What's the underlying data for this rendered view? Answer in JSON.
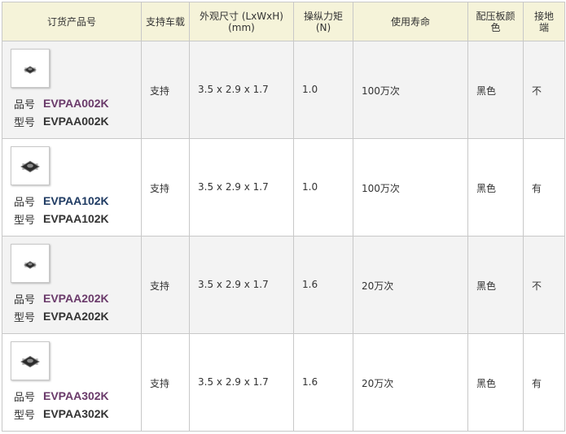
{
  "headers": {
    "product_no": "订货产品号",
    "car_support": "支持车载",
    "dimensions": "外观尺寸 (LxWxH)\n(mm)",
    "force": "操纵力矩\n(N)",
    "life": "使用寿命",
    "plate_color": "配压板颜色",
    "ground_terminal": "接地端"
  },
  "labels": {
    "pin": "品号",
    "model": "型号"
  },
  "rows": [
    {
      "pin": "EVPAA002K",
      "pin_color": "#6a3a6a",
      "model": "EVPAA002K",
      "car_support": "支持",
      "dimensions": "3.5 x 2.9 x 1.7",
      "force": "1.0",
      "life": "100万次",
      "plate_color": "黑色",
      "ground_terminal": "不",
      "thumb_size": "small"
    },
    {
      "pin": "EVPAA102K",
      "pin_color": "#1f3b63",
      "model": "EVPAA102K",
      "car_support": "支持",
      "dimensions": "3.5 x 2.9 x 1.7",
      "force": "1.0",
      "life": "100万次",
      "plate_color": "黑色",
      "ground_terminal": "有",
      "thumb_size": "large"
    },
    {
      "pin": "EVPAA202K",
      "pin_color": "#6a3a6a",
      "model": "EVPAA202K",
      "car_support": "支持",
      "dimensions": "3.5 x 2.9 x 1.7",
      "force": "1.6",
      "life": "20万次",
      "plate_color": "黑色",
      "ground_terminal": "不",
      "thumb_size": "small"
    },
    {
      "pin": "EVPAA302K",
      "pin_color": "#6a3a6a",
      "model": "EVPAA302K",
      "car_support": "支持",
      "dimensions": "3.5 x 2.9 x 1.7",
      "force": "1.6",
      "life": "20万次",
      "plate_color": "黑色",
      "ground_terminal": "有",
      "thumb_size": "large"
    }
  ]
}
